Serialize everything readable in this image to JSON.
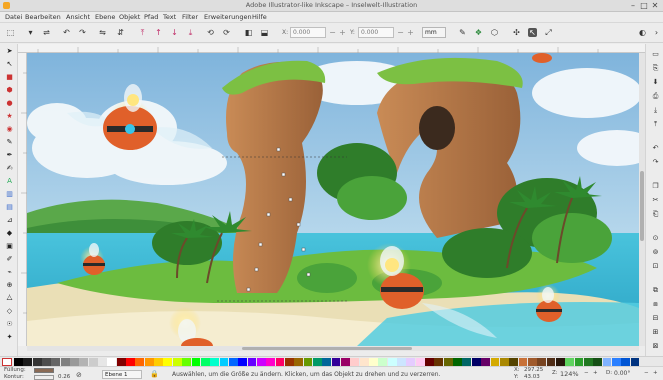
{
  "window": {
    "title": "Adobe Illustrator-like Inkscape – Inselwelt-Illustration",
    "buttons": [
      "–",
      "□",
      "✕"
    ]
  },
  "menu": [
    "Datei",
    "Bearbeiten",
    "Ansicht",
    "Ebene",
    "Objekt",
    "Pfad",
    "Text",
    "Filter",
    "Erweiterungen",
    "Hilfe"
  ],
  "toolbar": {
    "x_label": "X:",
    "x_value": "0.000",
    "y_label": "Y:",
    "y_value": "0.000",
    "unit": "mm"
  },
  "palette_colors": [
    "#000000",
    "#1a1a1a",
    "#333333",
    "#4d4d4d",
    "#666666",
    "#808080",
    "#999999",
    "#b3b3b3",
    "#cccccc",
    "#e6e6e6",
    "#ffffff",
    "#800000",
    "#ff0000",
    "#ff6600",
    "#ff9900",
    "#ffcc00",
    "#ffff00",
    "#ccff00",
    "#66ff00",
    "#00ff00",
    "#00ff66",
    "#00ffcc",
    "#00ccff",
    "#0066ff",
    "#0000ff",
    "#6600ff",
    "#cc00ff",
    "#ff00cc",
    "#ff0066",
    "#993300",
    "#996600",
    "#669900",
    "#009966",
    "#006699",
    "#330099",
    "#990066",
    "#ffcccc",
    "#ffe5cc",
    "#ffffcc",
    "#ccffcc",
    "#ccffff",
    "#cce5ff",
    "#e5ccff",
    "#ffccf2",
    "#660000",
    "#663300",
    "#666600",
    "#006600",
    "#006666",
    "#000066",
    "#660066",
    "#d4aa00",
    "#aa8800",
    "#554400",
    "#c87137",
    "#a05a2c",
    "#784421",
    "#502d16",
    "#28170b",
    "#5fd35f",
    "#2ca02c",
    "#217821",
    "#165016",
    "#80b3ff",
    "#2a7fff",
    "#0055d4",
    "#003380"
  ],
  "status": {
    "fill_label": "Füllung:",
    "stroke_label": "Kontur:",
    "stroke_value": "0.26",
    "layer": "Ebene 1",
    "message": "Auswählen, um die Größe zu ändern. Klicken, um das Objekt zu drehen und zu verzerren.",
    "x_label": "X:",
    "x_value": "297.25",
    "y_label": "Y:",
    "y_value": "43.03",
    "zoom": "124%",
    "rotation": "0.00°",
    "zoom_label": "Z:",
    "rot_label": "D:"
  },
  "colors": {
    "sky": "#9cc8e3",
    "rock": "#b87a48",
    "foliage": "#4a9a2c",
    "sea": "#3fb6cf",
    "sand": "#e9dfb6",
    "robot": "#e0602a"
  }
}
